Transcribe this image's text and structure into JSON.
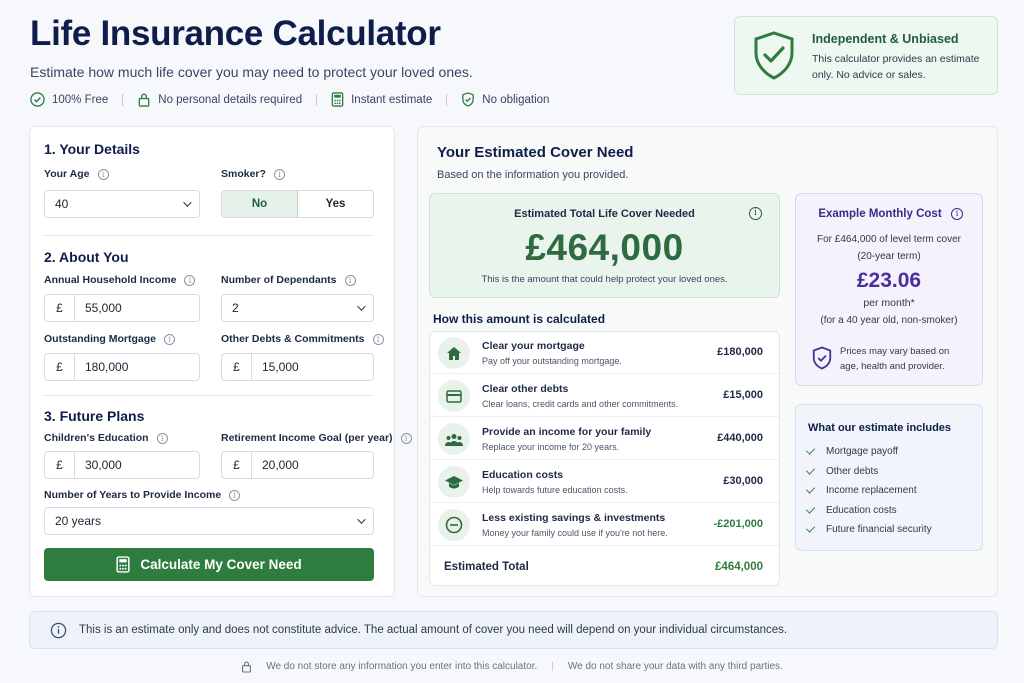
{
  "header": {
    "title": "Life Insurance Calculator",
    "subtitle": "Estimate how much life cover you may need to protect your loved ones.",
    "features": [
      "100% Free",
      "No personal details required",
      "Instant estimate",
      "No obligation"
    ]
  },
  "badge": {
    "title": "Independent & Unbiased",
    "text": "This calculator provides an estimate only. No advice or sales."
  },
  "form": {
    "section1": "1.  Your Details",
    "age_label": "Your Age",
    "age_value": "40",
    "smoker_label": "Smoker?",
    "smoker_no": "No",
    "smoker_yes": "Yes",
    "section2": "2.  About You",
    "income_label": "Annual Household Income",
    "income_value": "55,000",
    "dependants_label": "Number of Dependants",
    "dependants_value": "2",
    "mortgage_label": "Outstanding Mortgage",
    "mortgage_value": "180,000",
    "debts_label": "Other Debts & Commitments",
    "debts_value": "15,000",
    "section3": "3.  Future Plans",
    "education_label": "Children's Education",
    "education_value": "30,000",
    "retirement_label": "Retirement Income Goal (per year)",
    "retirement_value": "20,000",
    "years_label": "Number of Years to Provide Income",
    "years_value": "20 years",
    "currency": "£",
    "calculate_label": "Calculate My Cover Need"
  },
  "results": {
    "title": "Your Estimated Cover Need",
    "subtitle": "Based on the information you provided.",
    "total_label": "Estimated Total Life Cover Needed",
    "total_value": "£464,000",
    "total_note": "This is the amount that could help protect your loved ones.",
    "how_title": "How this amount is calculated",
    "rows": [
      {
        "title": "Clear your mortgage",
        "desc": "Pay off your outstanding mortgage.",
        "amount": "£180,000"
      },
      {
        "title": "Clear other debts",
        "desc": "Clear loans, credit cards and other commitments.",
        "amount": "£15,000"
      },
      {
        "title": "Provide an income for your family",
        "desc": "Replace your income for 20 years.",
        "amount": "£440,000"
      },
      {
        "title": "Education costs",
        "desc": "Help towards future education costs.",
        "amount": "£30,000"
      },
      {
        "title": "Less existing savings & investments",
        "desc": "Money your family could use if you're not here.",
        "amount": "-£201,000"
      }
    ],
    "estimated_total_label": "Estimated Total",
    "estimated_total_value": "£464,000"
  },
  "cost": {
    "title": "Example Monthly Cost",
    "line1": "For £464,000 of level term cover",
    "line2": "(20-year term)",
    "price": "£23.06",
    "per": "per month*",
    "who": "(for a 40 year old, non-smoker)",
    "note": "Prices may vary based on age, health and provider."
  },
  "includes": {
    "title": "What our estimate includes",
    "items": [
      "Mortgage payoff",
      "Other debts",
      "Income replacement",
      "Education costs",
      "Future financial security"
    ]
  },
  "disclaimer": "This is an estimate only and does not constitute advice. The actual amount of cover you need will depend on your individual circumstances.",
  "footer": {
    "left": "We do not store any information you enter into this calculator.",
    "right": "We do not share your data with any third parties."
  },
  "colors": {
    "primary_green": "#2e7d3f",
    "navy": "#0f1d4a",
    "purple": "#4b2fa0",
    "negative_green": "#2e7d3f"
  }
}
